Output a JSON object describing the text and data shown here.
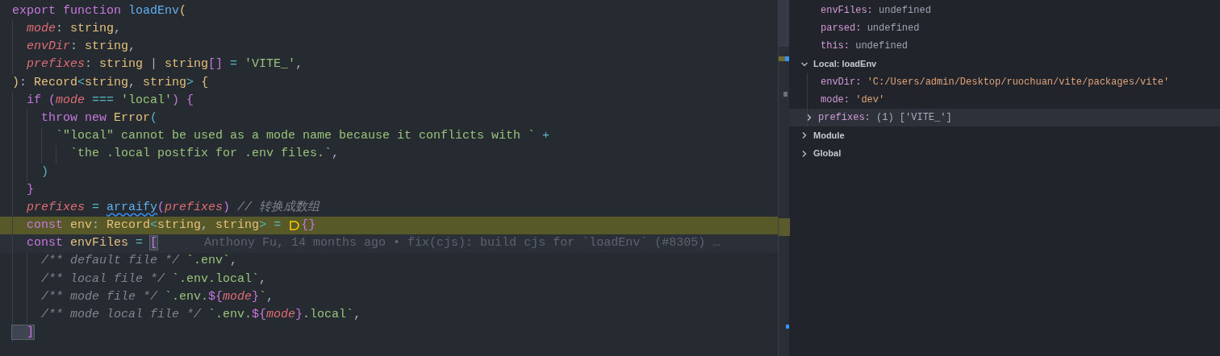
{
  "editor": {
    "lines": [
      {
        "tokens": [
          {
            "kind": "keyword",
            "text": "export"
          },
          {
            "kind": "keyword",
            "text": " function"
          },
          {
            "kind": "function",
            "text": " loadEnv"
          },
          {
            "kind": "paren1",
            "text": "("
          }
        ]
      },
      {
        "tokens": [
          {
            "kind": "param",
            "text": "  mode"
          },
          {
            "kind": "plain",
            "text": ": "
          },
          {
            "kind": "type",
            "text": "string"
          },
          {
            "kind": "plain",
            "text": ","
          }
        ]
      },
      {
        "tokens": [
          {
            "kind": "param",
            "text": "  envDir"
          },
          {
            "kind": "plain",
            "text": ": "
          },
          {
            "kind": "type",
            "text": "string"
          },
          {
            "kind": "plain",
            "text": ","
          }
        ]
      },
      {
        "tokens": [
          {
            "kind": "param",
            "text": "  prefixes"
          },
          {
            "kind": "plain",
            "text": ": "
          },
          {
            "kind": "type",
            "text": "string"
          },
          {
            "kind": "plain",
            "text": " | "
          },
          {
            "kind": "type",
            "text": "string"
          },
          {
            "kind": "paren2",
            "text": "[]"
          },
          {
            "kind": "operator",
            "text": " = "
          },
          {
            "kind": "string",
            "text": "'VITE_'"
          },
          {
            "kind": "plain",
            "text": ","
          }
        ]
      },
      {
        "tokens": [
          {
            "kind": "paren1",
            "text": ")"
          },
          {
            "kind": "plain",
            "text": ": "
          },
          {
            "kind": "type",
            "text": "Record"
          },
          {
            "kind": "operator",
            "text": "<"
          },
          {
            "kind": "type",
            "text": "string"
          },
          {
            "kind": "plain",
            "text": ", "
          },
          {
            "kind": "type",
            "text": "string"
          },
          {
            "kind": "operator",
            "text": ">"
          },
          {
            "kind": "paren1",
            "text": " {"
          }
        ]
      },
      {
        "tokens": [
          {
            "kind": "keyword",
            "text": "  if"
          },
          {
            "kind": "paren2",
            "text": " ("
          },
          {
            "kind": "param",
            "text": "mode"
          },
          {
            "kind": "operator",
            "text": " === "
          },
          {
            "kind": "string",
            "text": "'local'"
          },
          {
            "kind": "paren2",
            "text": ")"
          },
          {
            "kind": "paren2",
            "text": " {"
          }
        ]
      },
      {
        "tokens": [
          {
            "kind": "keyword",
            "text": "    throw"
          },
          {
            "kind": "keyword",
            "text": " new"
          },
          {
            "kind": "type",
            "text": " Error"
          },
          {
            "kind": "paren3",
            "text": "("
          }
        ]
      },
      {
        "tokens": [
          {
            "kind": "string",
            "text": "      `\"local\" cannot be used as a mode name because it conflicts with `"
          },
          {
            "kind": "operator",
            "text": " +"
          }
        ]
      },
      {
        "tokens": [
          {
            "kind": "string",
            "text": "        `the .local postfix for .env files.`"
          },
          {
            "kind": "plain",
            "text": ","
          }
        ]
      },
      {
        "tokens": [
          {
            "kind": "paren3",
            "text": "    )"
          }
        ]
      },
      {
        "tokens": [
          {
            "kind": "paren2",
            "text": "  }"
          }
        ]
      },
      {
        "tokens": [
          {
            "kind": "param",
            "text": "  prefixes"
          },
          {
            "kind": "operator",
            "text": " = "
          },
          {
            "kind": "function",
            "text": "arraify",
            "squiggle": true
          },
          {
            "kind": "paren2",
            "text": "("
          },
          {
            "kind": "param",
            "text": "prefixes"
          },
          {
            "kind": "paren2",
            "text": ")"
          },
          {
            "kind": "comment",
            "text": " // 转换成数组"
          }
        ]
      },
      {
        "current": true,
        "tokens": [
          {
            "kind": "keyword",
            "text": "  const"
          },
          {
            "kind": "type",
            "text": " env"
          },
          {
            "kind": "plain",
            "text": ": "
          },
          {
            "kind": "type",
            "text": "Record"
          },
          {
            "kind": "operator",
            "text": "<"
          },
          {
            "kind": "type",
            "text": "string"
          },
          {
            "kind": "plain",
            "text": ", "
          },
          {
            "kind": "type",
            "text": "string"
          },
          {
            "kind": "operator",
            "text": ">"
          },
          {
            "kind": "operator",
            "text": " = "
          },
          {
            "kind": "breakpoint"
          },
          {
            "kind": "paren2",
            "text": "{}"
          }
        ]
      },
      {
        "blame": "Anthony Fu, 14 months ago • fix(cjs): build cjs for `loadEnv` (#8305) …",
        "tokens": [
          {
            "kind": "keyword",
            "text": "  const"
          },
          {
            "kind": "type",
            "text": " envFiles"
          },
          {
            "kind": "operator",
            "text": " = "
          },
          {
            "kind": "paren2",
            "text": "[",
            "matched": true
          }
        ]
      },
      {
        "tokens": [
          {
            "kind": "comment",
            "text": "    /** default file */"
          },
          {
            "kind": "string",
            "text": " `.env`"
          },
          {
            "kind": "plain",
            "text": ","
          }
        ]
      },
      {
        "tokens": [
          {
            "kind": "comment",
            "text": "    /** local file */"
          },
          {
            "kind": "string",
            "text": " `.env.local`"
          },
          {
            "kind": "plain",
            "text": ","
          }
        ]
      },
      {
        "tokens": [
          {
            "kind": "comment",
            "text": "    /** mode file */"
          },
          {
            "kind": "string",
            "text": " `.env."
          },
          {
            "kind": "paren2",
            "text": "${"
          },
          {
            "kind": "param",
            "text": "mode"
          },
          {
            "kind": "paren2",
            "text": "}"
          },
          {
            "kind": "string",
            "text": "`"
          },
          {
            "kind": "plain",
            "text": ","
          }
        ]
      },
      {
        "tokens": [
          {
            "kind": "comment",
            "text": "    /** mode local file */"
          },
          {
            "kind": "string",
            "text": " `.env."
          },
          {
            "kind": "paren2",
            "text": "${"
          },
          {
            "kind": "param",
            "text": "mode"
          },
          {
            "kind": "paren2",
            "text": "}"
          },
          {
            "kind": "string",
            "text": ".local`"
          },
          {
            "kind": "plain",
            "text": ","
          }
        ]
      },
      {
        "tokens": [
          {
            "kind": "paren2",
            "text": "  ]",
            "matched": true
          }
        ]
      }
    ]
  },
  "debug_panel": {
    "variables": [
      {
        "name": "envFiles:",
        "value": "undefined",
        "kind": "unset",
        "hovered": false
      },
      {
        "name": "parsed:",
        "value": "undefined",
        "kind": "unset",
        "hovered": false
      },
      {
        "name": "this:",
        "value": "undefined",
        "kind": "unset",
        "hovered": false
      }
    ],
    "scopes": [
      {
        "label": "Local: loadEnv",
        "expanded": true,
        "children": [
          {
            "name": "envDir:",
            "value": "'C:/Users/admin/Desktop/ruochuan/vite/packages/vite'",
            "kind": "string",
            "hovered": false
          },
          {
            "name": "mode:",
            "value": "'dev'",
            "kind": "string",
            "hovered": false
          },
          {
            "name": "prefixes:",
            "value": "(1) ['VITE_']",
            "kind": "object",
            "hovered": true,
            "expandable": true
          }
        ]
      },
      {
        "label": "Module",
        "expanded": false
      },
      {
        "label": "Global",
        "expanded": false
      }
    ]
  }
}
